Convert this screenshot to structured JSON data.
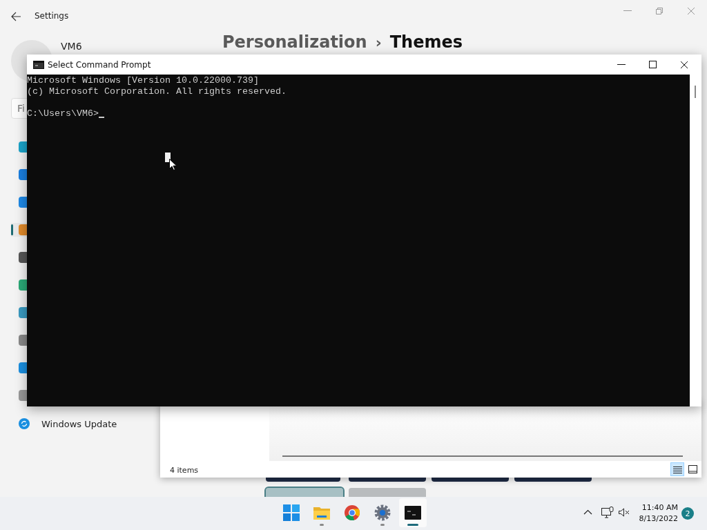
{
  "settings": {
    "title": "Settings",
    "user": "VM6",
    "breadcrumb": [
      "Personalization",
      "Themes"
    ],
    "separator": "›",
    "search": {
      "placeholder": "Fi"
    },
    "sidebar": {
      "items": [
        {
          "selected": false
        },
        {
          "selected": false
        },
        {
          "selected": false
        },
        {
          "selected": true
        },
        {
          "selected": false
        },
        {
          "selected": false
        },
        {
          "selected": false
        },
        {
          "selected": false
        },
        {
          "selected": false
        },
        {
          "selected": false
        },
        {
          "label": "Windows Update",
          "selected": false
        }
      ]
    },
    "themes": [
      {
        "selected": false
      },
      {
        "selected": false
      },
      {
        "selected": false
      },
      {
        "selected": false
      },
      {
        "selected": true
      },
      {
        "selected": false
      }
    ]
  },
  "file_window": {
    "status": "4 items",
    "views": [
      {
        "kind": "details",
        "selected": true
      },
      {
        "kind": "tiles",
        "selected": false
      }
    ]
  },
  "cmd_window": {
    "title": "Select Command Prompt",
    "blocks": [
      [
        "Microsoft Windows [Version 10.0.22000.739]",
        "(c) Microsoft Corporation. All rights reserved."
      ],
      [
        "C:\\Users\\VM6>"
      ]
    ]
  },
  "taskbar": {
    "apps": [
      {
        "kind": "start",
        "running": false,
        "active": false
      },
      {
        "kind": "explorer",
        "running": true,
        "active": false
      },
      {
        "kind": "chrome",
        "running": false,
        "active": false
      },
      {
        "kind": "settings",
        "running": true,
        "active": false
      },
      {
        "kind": "cmd",
        "running": true,
        "active": true
      }
    ],
    "time": "11:40 AM",
    "date": "8/13/2022",
    "notifications": "2"
  }
}
